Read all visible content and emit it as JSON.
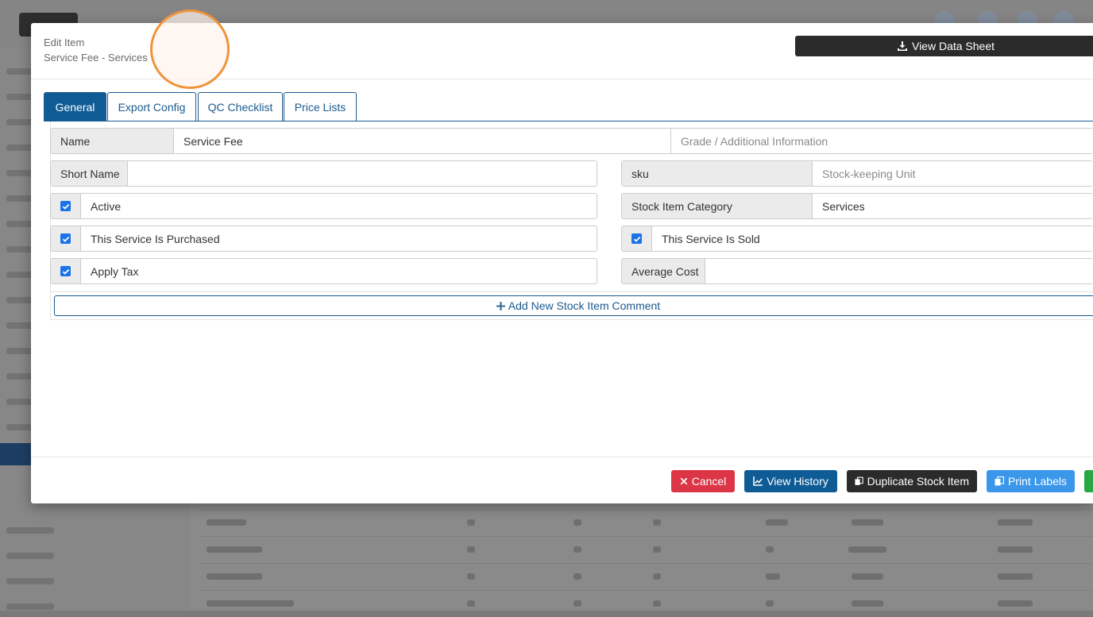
{
  "modal": {
    "title_small": "Edit Item",
    "title": "Service Fee - Services",
    "datasheet_label": "View Data Sheet"
  },
  "tabs": [
    {
      "label": "General",
      "active": true
    },
    {
      "label": "Export Config",
      "active": false
    },
    {
      "label": "QC Checklist",
      "active": false
    },
    {
      "label": "Price Lists",
      "active": false
    }
  ],
  "form": {
    "name": {
      "label": "Name",
      "value": "Service Fee",
      "grade_placeholder": "Grade / Additional Information"
    },
    "short_name": {
      "label": "Short Name",
      "value": ""
    },
    "sku": {
      "label": "sku",
      "placeholder": "Stock-keeping Unit"
    },
    "active": {
      "label": "Active",
      "checked": true
    },
    "category": {
      "label": "Stock Item Category",
      "value": "Services"
    },
    "purchased": {
      "label": "This Service Is Purchased",
      "checked": true
    },
    "sold": {
      "label": "This Service Is Sold",
      "checked": true
    },
    "apply_tax": {
      "label": "Apply Tax",
      "checked": true
    },
    "average_cost": {
      "label": "Average Cost",
      "value": ""
    },
    "add_comment_label": "Add New Stock Item Comment"
  },
  "footer": {
    "cancel": "Cancel",
    "view_history": "View History",
    "duplicate": "Duplicate Stock Item",
    "print_labels": "Print Labels"
  },
  "colors": {
    "primary": "#0f5b95",
    "cancel": "#dc3545",
    "dark": "#2b2b2b",
    "info": "#3a97ea",
    "success": "#28a745",
    "cursor_ring": "#f0943a"
  },
  "icons": [
    "download-icon",
    "check-icon",
    "plus-icon",
    "times-icon",
    "line-chart-icon",
    "copy-icon"
  ]
}
